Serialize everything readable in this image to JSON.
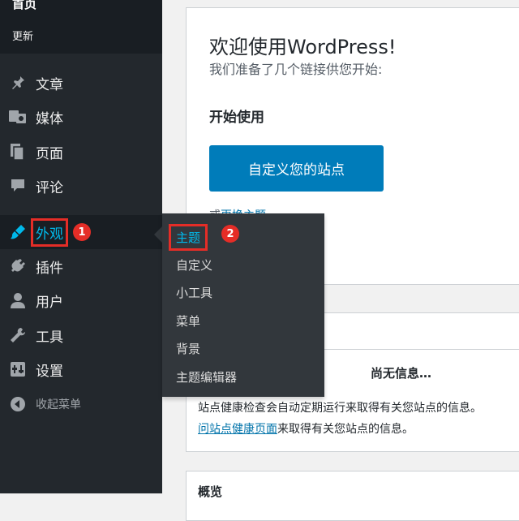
{
  "sidebar": {
    "home": "首页",
    "updates": "更新",
    "items": [
      {
        "label": "文章",
        "icon": "pin-icon"
      },
      {
        "label": "媒体",
        "icon": "media-icon"
      },
      {
        "label": "页面",
        "icon": "page-icon"
      },
      {
        "label": "评论",
        "icon": "comment-icon"
      },
      {
        "label": "外观",
        "icon": "brush-icon",
        "badge": "1"
      },
      {
        "label": "插件",
        "icon": "plugin-icon"
      },
      {
        "label": "用户",
        "icon": "user-icon"
      },
      {
        "label": "工具",
        "icon": "wrench-icon"
      },
      {
        "label": "设置",
        "icon": "settings-icon"
      }
    ],
    "collapse": "收起菜单"
  },
  "submenu": {
    "items": [
      "主题",
      "自定义",
      "小工具",
      "菜单",
      "背景",
      "主题编辑器"
    ],
    "badge": "2"
  },
  "welcome": {
    "title": "欢迎使用WordPress!",
    "subtitle": "我们准备了几个链接供您开始:",
    "get_started": "开始使用",
    "customize_button": "自定义您的站点",
    "or_prefix": "或",
    "change_theme_link": "更换主题"
  },
  "health": {
    "no_info": "尚无信息…",
    "line1": "站点健康检查会自动定期运行来取得有关您站点的信息。",
    "line2_link": "问站点健康页面",
    "line2_rest": "来取得有关您站点的信息。"
  },
  "overview": {
    "title": "概览"
  },
  "colors": {
    "sidebar_bg": "#23282d",
    "accent": "#00b9eb",
    "button": "#007cba",
    "highlight": "#e52d27"
  }
}
